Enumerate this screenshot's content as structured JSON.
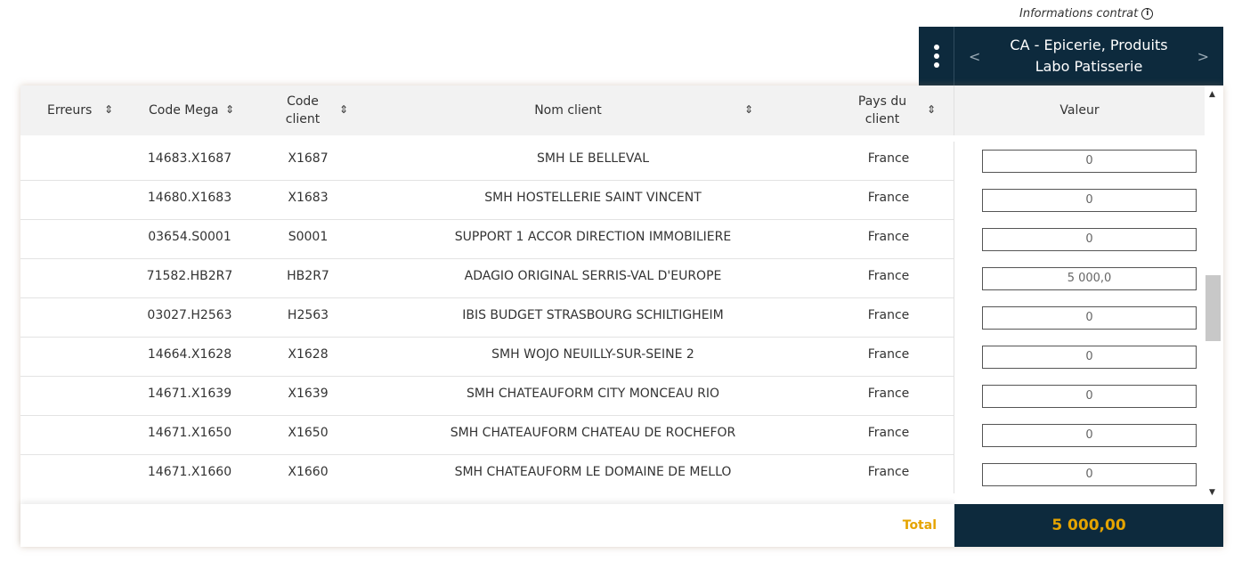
{
  "info": {
    "label": "Informations contrat",
    "icon": "info-circle-icon"
  },
  "column": {
    "title": "CA - Epicerie, Produits Labo Patisserie",
    "prev_arrow": "<",
    "next_arrow": ">",
    "menu_icon": "kebab-menu-icon"
  },
  "headers": {
    "erreurs": "Erreurs",
    "code_mega": "Code Mega",
    "code_client": "Code client",
    "nom_client": "Nom client",
    "pays_client": "Pays du client",
    "valeur": "Valeur",
    "sort_glyph": "⇕"
  },
  "rows": [
    {
      "erreurs": "",
      "code_mega": "14683.X1687",
      "code_client": "X1687",
      "nom_client": "SMH LE BELLEVAL",
      "pays": "France",
      "valeur": "0"
    },
    {
      "erreurs": "",
      "code_mega": "14680.X1683",
      "code_client": "X1683",
      "nom_client": "SMH HOSTELLERIE SAINT VINCENT",
      "pays": "France",
      "valeur": "0"
    },
    {
      "erreurs": "",
      "code_mega": "03654.S0001",
      "code_client": "S0001",
      "nom_client": "SUPPORT 1 ACCOR DIRECTION IMMOBILIERE",
      "pays": "France",
      "valeur": "0"
    },
    {
      "erreurs": "",
      "code_mega": "71582.HB2R7",
      "code_client": "HB2R7",
      "nom_client": "ADAGIO ORIGINAL SERRIS-VAL D'EUROPE",
      "pays": "France",
      "valeur": "5 000,0"
    },
    {
      "erreurs": "",
      "code_mega": "03027.H2563",
      "code_client": "H2563",
      "nom_client": "IBIS BUDGET STRASBOURG SCHILTIGHEIM",
      "pays": "France",
      "valeur": "0"
    },
    {
      "erreurs": "",
      "code_mega": "14664.X1628",
      "code_client": "X1628",
      "nom_client": "SMH WOJO NEUILLY-SUR-SEINE 2",
      "pays": "France",
      "valeur": "0"
    },
    {
      "erreurs": "",
      "code_mega": "14671.X1639",
      "code_client": "X1639",
      "nom_client": "SMH CHATEAUFORM CITY MONCEAU RIO",
      "pays": "France",
      "valeur": "0"
    },
    {
      "erreurs": "",
      "code_mega": "14671.X1650",
      "code_client": "X1650",
      "nom_client": "SMH CHATEAUFORM CHATEAU DE ROCHEFOR",
      "pays": "France",
      "valeur": "0"
    },
    {
      "erreurs": "",
      "code_mega": "14671.X1660",
      "code_client": "X1660",
      "nom_client": "SMH CHATEAUFORM LE DOMAINE DE MELLO",
      "pays": "France",
      "valeur": "0"
    }
  ],
  "footer": {
    "total_label": "Total",
    "total_value": "5 000,00"
  },
  "scrollbar": {
    "up": "▲",
    "down": "▼"
  },
  "colors": {
    "header_dark": "#0d2a3d",
    "accent": "#e5a400",
    "header_bg": "#f2f2f2"
  }
}
